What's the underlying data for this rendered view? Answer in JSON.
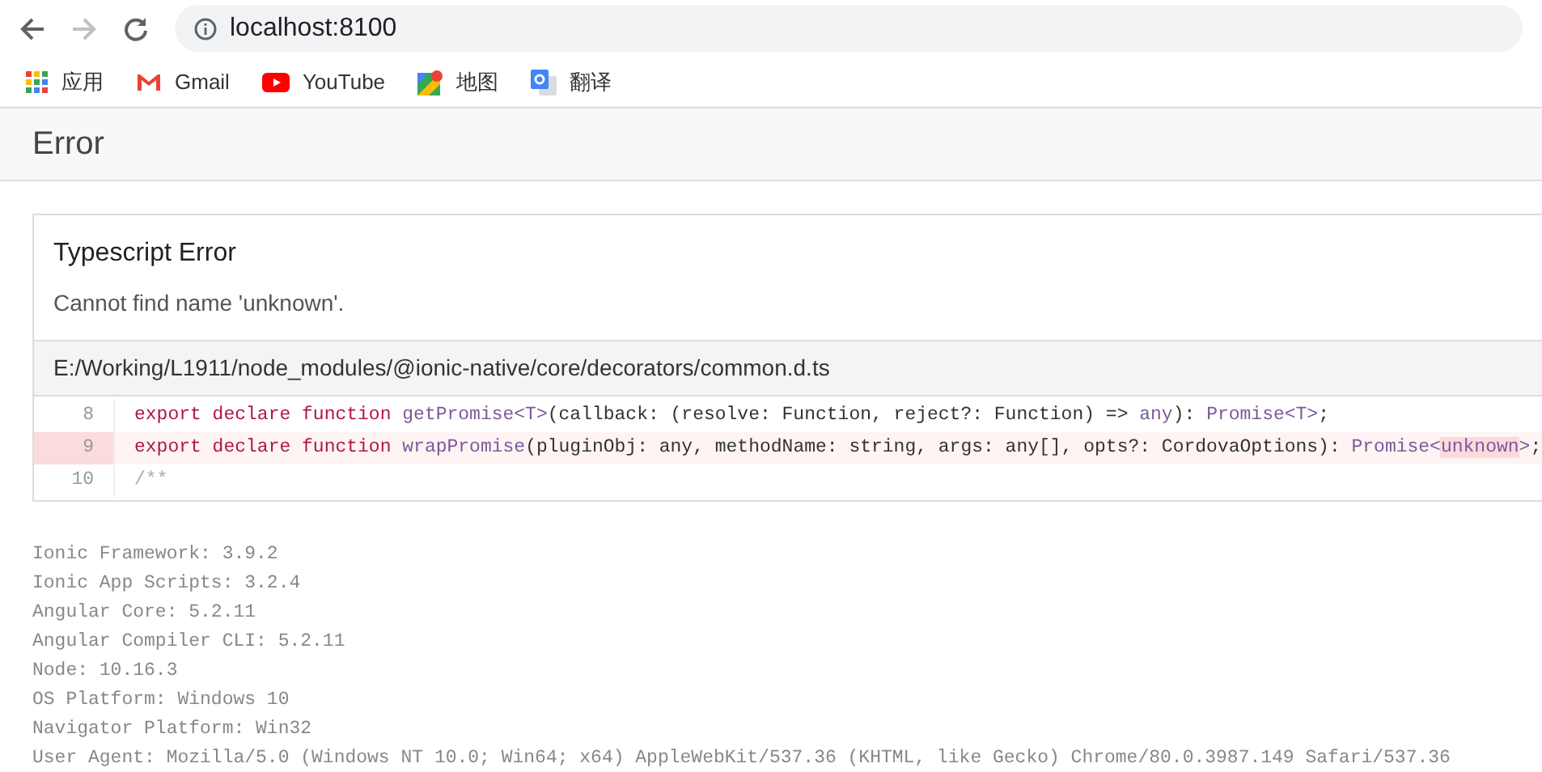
{
  "browser": {
    "address": "localhost:8100",
    "bookmarks": [
      {
        "kind": "apps",
        "label": "应用"
      },
      {
        "kind": "gmail",
        "label": "Gmail"
      },
      {
        "kind": "youtube",
        "label": "YouTube"
      },
      {
        "kind": "maps",
        "label": "地图"
      },
      {
        "kind": "translate",
        "label": "翻译"
      }
    ]
  },
  "header": {
    "title": "Error"
  },
  "error": {
    "title": "Typescript Error",
    "message": "Cannot find name 'unknown'.",
    "file": "E:/Working/L1911/node_modules/@ionic-native/core/decorators/common.d.ts",
    "lines": [
      {
        "number": "8",
        "highlighted": false,
        "tokens": [
          {
            "kind": "keyword",
            "text": "export declare function "
          },
          {
            "kind": "type",
            "text": "getPromise<T>"
          },
          {
            "kind": "plain",
            "text": "(callback: (resolve: Function, reject?: Function) => "
          },
          {
            "kind": "type",
            "text": "any"
          },
          {
            "kind": "plain",
            "text": "): "
          },
          {
            "kind": "type",
            "text": "Promise<T>"
          },
          {
            "kind": "plain",
            "text": ";"
          }
        ]
      },
      {
        "number": "9",
        "highlighted": true,
        "tokens": [
          {
            "kind": "keyword",
            "text": "export declare function "
          },
          {
            "kind": "type",
            "text": "wrapPromise"
          },
          {
            "kind": "plain",
            "text": "(pluginObj: any, methodName: string, args: any[], opts?: CordovaOptions): "
          },
          {
            "kind": "type",
            "text": "Promise<"
          },
          {
            "kind": "error",
            "text": "unknown"
          },
          {
            "kind": "type",
            "text": ">"
          },
          {
            "kind": "plain",
            "text": ";"
          }
        ]
      },
      {
        "number": "10",
        "highlighted": false,
        "tokens": [
          {
            "kind": "comment",
            "text": "/**"
          }
        ]
      }
    ]
  },
  "environment": [
    "Ionic Framework: 3.9.2",
    "Ionic App Scripts: 3.2.4",
    "Angular Core: 5.2.11",
    "Angular Compiler CLI: 5.2.11",
    "Node: 10.16.3",
    "OS Platform: Windows 10",
    "Navigator Platform: Win32",
    "User Agent: Mozilla/5.0 (Windows NT 10.0; Win64; x64) AppleWebKit/537.36 (KHTML, like Gecko) Chrome/80.0.3987.149 Safari/537.36"
  ]
}
